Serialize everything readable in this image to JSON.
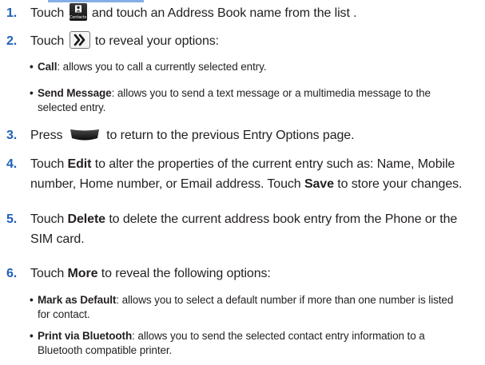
{
  "icons": {
    "contacts_label": "Contacts"
  },
  "steps": [
    {
      "num": "1.",
      "parts": {
        "a": "Touch ",
        "b": " and touch an Address Book name from the list ."
      }
    },
    {
      "num": "2.",
      "parts": {
        "a": "Touch ",
        "b": " to reveal your options:"
      },
      "bullets": [
        {
          "term": "Call",
          "desc": ": allows you to call a currently selected entry."
        },
        {
          "term": "Send Message",
          "desc": ": allows you to send a text message or a multimedia message to the",
          "desc2": "selected entry."
        }
      ]
    },
    {
      "num": "3.",
      "parts": {
        "a": "Press ",
        "b": " to return to the previous Entry Options page."
      }
    },
    {
      "num": "4.",
      "line1a": "Touch ",
      "line1term": "Edit",
      "line1b": " to alter the properties of the current entry such as: Name, Mobile",
      "line2a": "number, Home number, or Email address. Touch ",
      "line2term": "Save",
      "line2b": " to store your changes."
    },
    {
      "num": "5.",
      "line1a": "Touch ",
      "line1term": "Delete",
      "line1b": " to delete the current address book entry from the Phone or the",
      "line2": "SIM card."
    },
    {
      "num": "6.",
      "line1a": "Touch ",
      "line1term": "More",
      "line1b": " to reveal the following options:",
      "bullets": [
        {
          "term": "Mark as Default",
          "desc": ": allows you to select a default number if more than one number is listed",
          "desc2": "for contact."
        },
        {
          "term": "Print via Bluetooth",
          "desc": ": allows you to send the selected contact entry information to a",
          "desc2": "Bluetooth compatible printer."
        }
      ]
    }
  ]
}
